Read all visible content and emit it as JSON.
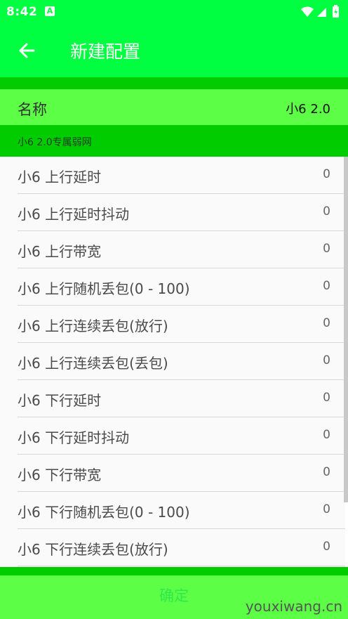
{
  "status_bar": {
    "time": "8:42",
    "notification_icon": "A"
  },
  "app_bar": {
    "title": "新建配置"
  },
  "name_row": {
    "label": "名称",
    "value": "小6 2.0"
  },
  "section": {
    "label": "小6 2.0专属弱网"
  },
  "list": {
    "items": [
      {
        "label": "小6  上行延时",
        "value": "0"
      },
      {
        "label": "小6  上行延时抖动",
        "value": "0"
      },
      {
        "label": "小6  上行带宽",
        "value": "0"
      },
      {
        "label": "小6  上行随机丢包(0 - 100)",
        "value": "0"
      },
      {
        "label": "小6  上行连续丢包(放行)",
        "value": "0"
      },
      {
        "label": "小6  上行连续丢包(丢包)",
        "value": "0"
      },
      {
        "label": "小6  下行延时",
        "value": "0"
      },
      {
        "label": "小6  下行延时抖动",
        "value": "0"
      },
      {
        "label": "小6  下行带宽",
        "value": "0"
      },
      {
        "label": "小6  下行随机丢包(0 - 100)",
        "value": "0"
      },
      {
        "label": "小6  下行连续丢包(放行)",
        "value": "0"
      }
    ]
  },
  "confirm_button": {
    "label": "确定"
  },
  "watermark": "youxiwang.cn",
  "colors": {
    "primary": "#00ff40",
    "dark_band": "#00cc00",
    "light_row": "#5cff45"
  }
}
